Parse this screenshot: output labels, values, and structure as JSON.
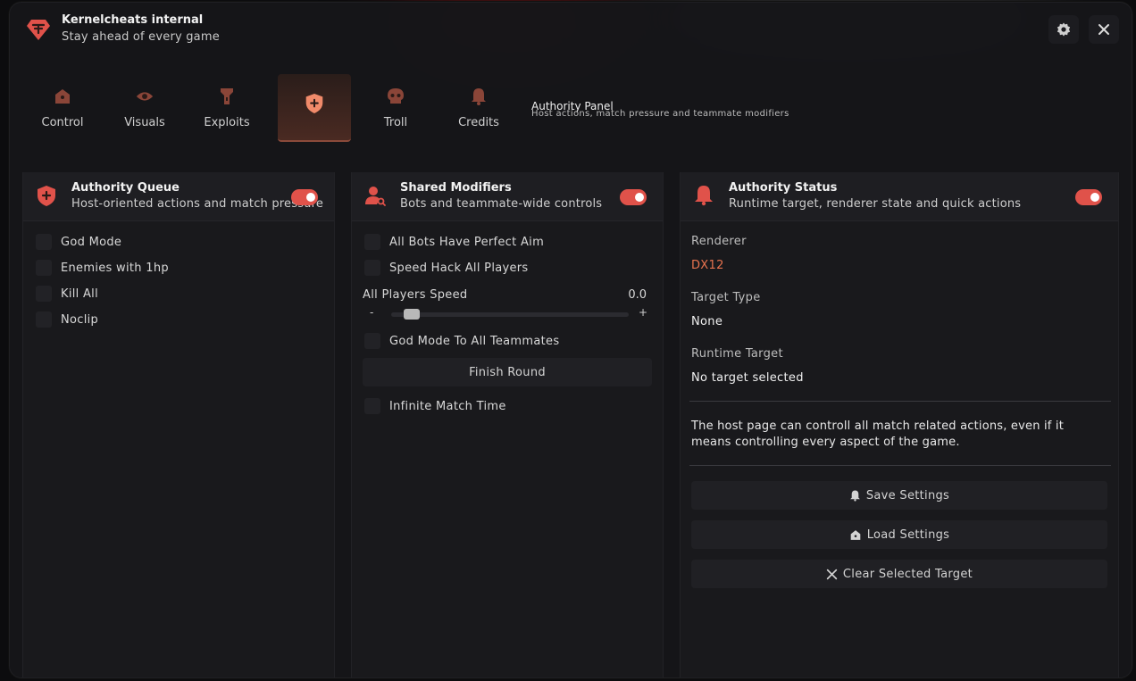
{
  "app": {
    "title": "Kernelcheats internal",
    "subtitle": "Stay ahead of every game"
  },
  "titlebar": {
    "settings_icon": "gear-icon",
    "close_icon": "close-icon"
  },
  "tabs": [
    {
      "label": "Control",
      "icon": "home-icon",
      "active": false
    },
    {
      "label": "Visuals",
      "icon": "eye-icon",
      "active": false
    },
    {
      "label": "Exploits",
      "icon": "flashlight-icon",
      "active": false
    },
    {
      "label": "",
      "icon": "shield-plus-icon",
      "active": true
    },
    {
      "label": "Troll",
      "icon": "skull-icon",
      "active": false
    },
    {
      "label": "Credits",
      "icon": "bell-icon",
      "active": false
    }
  ],
  "panel": {
    "title": "Authority Panel",
    "subtitle": "Host actions, match pressure and teammate modifiers"
  },
  "queue": {
    "title": "Authority Queue",
    "subtitle": "Host-oriented actions and match pressure",
    "enabled": true,
    "items": [
      "God Mode",
      "Enemies with 1hp",
      "Kill All",
      "Noclip"
    ]
  },
  "modifiers": {
    "title": "Shared Modifiers",
    "subtitle": "Bots and teammate-wide controls",
    "enabled": true,
    "item1": "All Bots Have Perfect Aim",
    "item2": "Speed Hack All Players",
    "slider_label": "All Players Speed",
    "slider_value": "0.0",
    "slider_fraction": 0.0,
    "minus": "-",
    "plus": "+",
    "item3": "God Mode To All Teammates",
    "finish_button": "Finish Round",
    "item4": "Infinite Match Time"
  },
  "status": {
    "title": "Authority Status",
    "subtitle": "Runtime target, renderer state and quick actions",
    "enabled": true,
    "renderer_label": "Renderer",
    "renderer_value": "DX12",
    "target_type_label": "Target Type",
    "target_type_value": "None",
    "runtime_label": "Runtime Target",
    "runtime_value": "No target selected",
    "note": "The host page can controll all match related actions, even if it means controlling every aspect of the game.",
    "save_button": "Save Settings",
    "load_button": "Load Settings",
    "clear_button": "Clear Selected Target"
  },
  "colors": {
    "accent": "#e0524a",
    "renderer_value": "#e8734f",
    "icon_dim": "#8a4538"
  }
}
